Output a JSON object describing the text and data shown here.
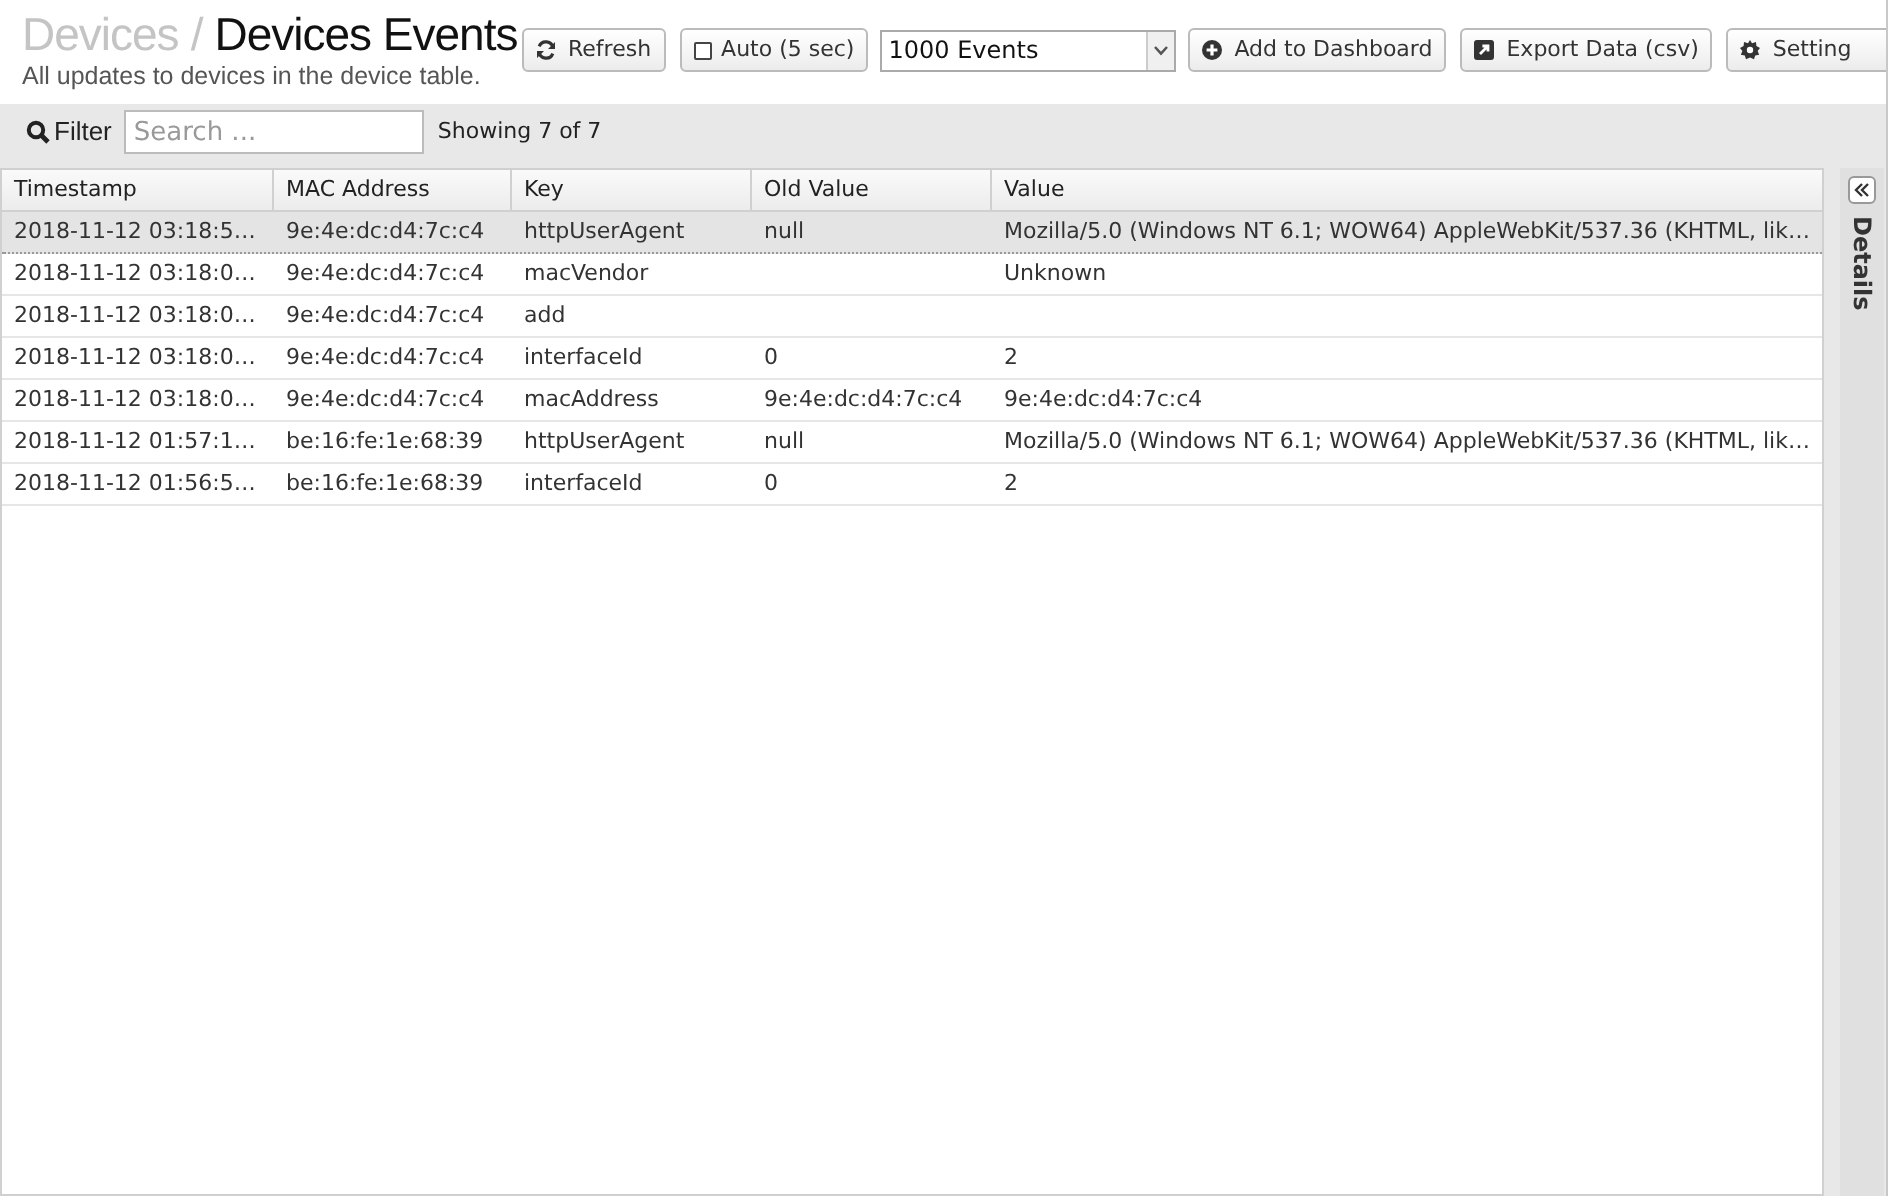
{
  "breadcrumb": {
    "parent": "Devices",
    "separator": "/",
    "current": "Devices Events"
  },
  "subtitle": "All updates to devices in the device table.",
  "toolbar": [
    {
      "kind": "button",
      "label": "Refresh"
    },
    {
      "kind": "checkbox",
      "label": "Auto (5 sec)",
      "checked": false
    },
    {
      "kind": "select",
      "value": "1000 Events"
    },
    {
      "kind": "button",
      "label": "Add to Dashboard"
    },
    {
      "kind": "button",
      "label": "Export Data (csv)"
    },
    {
      "kind": "button",
      "label": "Setting"
    }
  ],
  "filter": {
    "label": "Filter",
    "placeholder": "Search ...",
    "count": "Showing 7 of 7"
  },
  "table": {
    "columns": [
      "Timestamp",
      "MAC Address",
      "Key",
      "Old Value",
      "Value"
    ],
    "rows": [
      {
        "selected": true,
        "cells": [
          "2018-11-12 03:18:5…",
          "9e:4e:dc:d4:7c:c4",
          "httpUserAgent",
          "null",
          "Mozilla/5.0 (Windows NT 6.1; WOW64) AppleWebKit/537.36 (KHTML, lik…"
        ]
      },
      {
        "selected": false,
        "cells": [
          "2018-11-12 03:18:0…",
          "9e:4e:dc:d4:7c:c4",
          "macVendor",
          "",
          "Unknown"
        ]
      },
      {
        "selected": false,
        "cells": [
          "2018-11-12 03:18:0…",
          "9e:4e:dc:d4:7c:c4",
          "add",
          "",
          ""
        ]
      },
      {
        "selected": false,
        "cells": [
          "2018-11-12 03:18:0…",
          "9e:4e:dc:d4:7c:c4",
          "interfaceId",
          "0",
          "2"
        ]
      },
      {
        "selected": false,
        "cells": [
          "2018-11-12 03:18:0…",
          "9e:4e:dc:d4:7c:c4",
          "macAddress",
          "9e:4e:dc:d4:7c:c4",
          "9e:4e:dc:d4:7c:c4"
        ]
      },
      {
        "selected": false,
        "cells": [
          "2018-11-12 01:57:1…",
          "be:16:fe:1e:68:39",
          "httpUserAgent",
          "null",
          "Mozilla/5.0 (Windows NT 6.1; WOW64) AppleWebKit/537.36 (KHTML, lik…"
        ]
      },
      {
        "selected": false,
        "cells": [
          "2018-11-12 01:56:5…",
          "be:16:fe:1e:68:39",
          "interfaceId",
          "0",
          "2"
        ]
      }
    ]
  },
  "details_panel": {
    "label": "Details",
    "expanded": false
  }
}
